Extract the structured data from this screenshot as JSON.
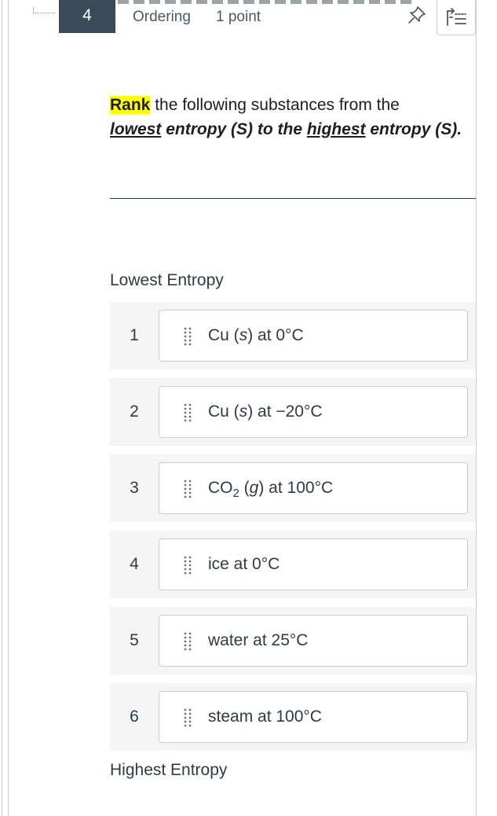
{
  "question": {
    "number": "4",
    "type": "Ordering",
    "points": "1 point"
  },
  "icons": {
    "pin": "pin-icon",
    "outline": "question-list-icon",
    "drag": "drag-handle-icon"
  },
  "prompt": {
    "highlight": "Rank",
    "rest_line1": " the following substances from the ",
    "lowest": "lowest",
    "mid": " entropy (S) to the ",
    "highest": "highest",
    "tail": " entropy (S)."
  },
  "labels": {
    "top": "Lowest Entropy",
    "bottom": "Highest Entropy"
  },
  "items": [
    {
      "rank": "1",
      "a": "Cu (",
      "i": "s",
      "b": ") at 0°C"
    },
    {
      "rank": "2",
      "a": "Cu (",
      "i": "s",
      "b": ") at −20°C"
    },
    {
      "rank": "3",
      "a": "CO",
      "sub": "2",
      "a2": " (",
      "i": "g",
      "b": ") at 100°C"
    },
    {
      "rank": "4",
      "a": "ice at 0°C"
    },
    {
      "rank": "5",
      "a": "water at 25°C"
    },
    {
      "rank": "6",
      "a": "steam at 100°C"
    }
  ],
  "colors": {
    "header_badge": "#394b58",
    "highlight": "#ffff00",
    "row_bg": "#f5f5f5",
    "card_border": "#c7cdd1"
  }
}
